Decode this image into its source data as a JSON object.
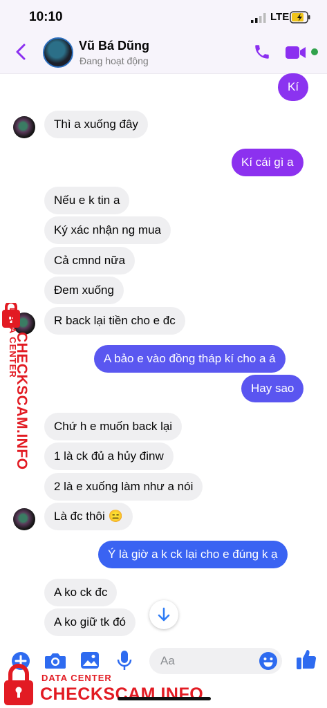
{
  "status_bar": {
    "time": "10:10",
    "network": "LTE"
  },
  "header": {
    "name": "Vũ Bá Dũng",
    "status": "Đang hoạt động"
  },
  "messages": [
    {
      "text": "Kí",
      "from": "me"
    },
    {
      "text": "Thì a xuống đây",
      "from": "them"
    },
    {
      "text": "Kí cái gì a",
      "from": "me"
    },
    {
      "text": "Nếu e k tin a",
      "from": "them"
    },
    {
      "text": "Ký xác nhận ng mua",
      "from": "them"
    },
    {
      "text": "Cả cmnd nữa",
      "from": "them"
    },
    {
      "text": "Đem xuống",
      "from": "them"
    },
    {
      "text": "R back lại tiền cho e đc",
      "from": "them"
    },
    {
      "text": "A bảo e vào đồng tháp kí cho a á",
      "from": "me"
    },
    {
      "text": "Hay sao",
      "from": "me"
    },
    {
      "text": "Chứ h e muốn back lại",
      "from": "them"
    },
    {
      "text": "1 là ck đủ a hủy đinw",
      "from": "them"
    },
    {
      "text": "2 là e xuống làm như a nói",
      "from": "them"
    },
    {
      "text": "Là đc thôi 😑",
      "from": "them"
    },
    {
      "text": "Ý là giờ a k ck lại cho e đúng k ạ",
      "from": "me"
    },
    {
      "text": "A ko ck đc",
      "from": "them"
    },
    {
      "text": "A ko giữ tk đó",
      "from": "them"
    }
  ],
  "composer": {
    "placeholder": "Aa"
  },
  "watermark": {
    "title": "DATA CENTER",
    "brand": "CHECKSCAM.INFO"
  },
  "colors": {
    "accent": "#8b2ff0",
    "accent_blue": "#3a63f2",
    "incoming": "#efeff1",
    "watermark": "#e21b23"
  },
  "icons": [
    "back-chevron-icon",
    "phone-icon",
    "video-camera-icon",
    "scroll-down-arrow-icon",
    "plus-icon",
    "camera-icon",
    "image-icon",
    "microphone-icon",
    "emoji-icon",
    "thumbs-up-icon",
    "lock-icon"
  ]
}
